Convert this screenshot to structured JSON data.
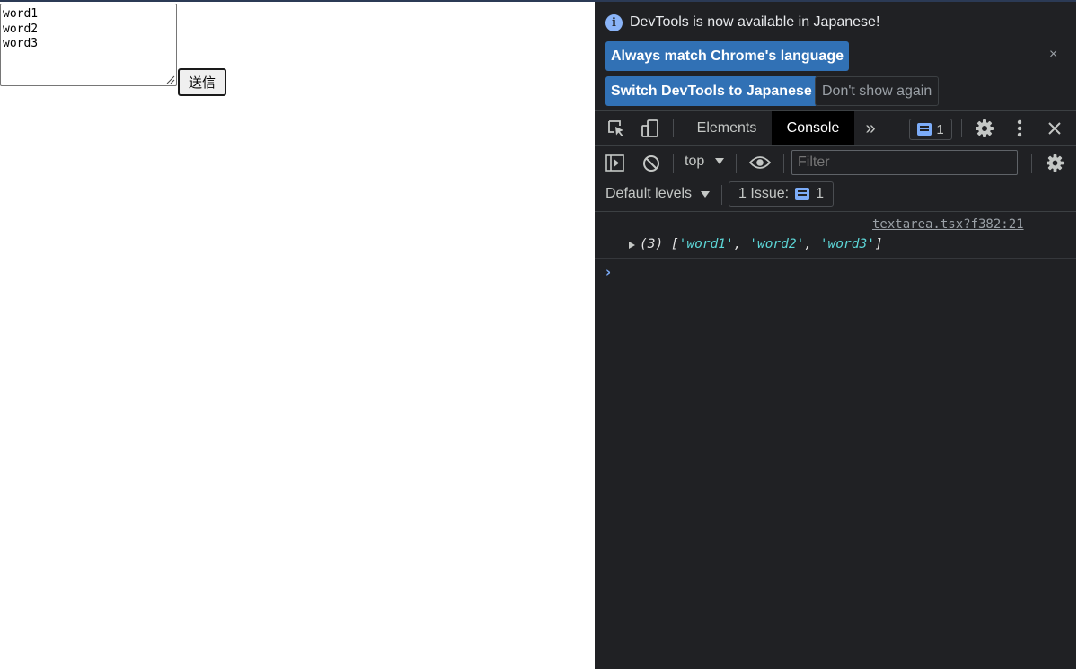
{
  "page": {
    "textarea_value": "word1\nword2\nword3",
    "submit_label": "送信"
  },
  "devtools": {
    "infobar": {
      "message": "DevTools is now available in Japanese!",
      "match_language_label": "Always match Chrome's language",
      "switch_label": "Switch DevTools to Japanese",
      "dismiss_label": "Don't show again",
      "close_symbol": "×"
    },
    "tabs": {
      "elements": "Elements",
      "console": "Console",
      "more": "»"
    },
    "issues_badge_count": "1",
    "console_toolbar": {
      "context": "top",
      "filter_placeholder": "Filter",
      "default_levels": "Default levels",
      "issues_label": "1 Issue:",
      "issues_count": "1"
    },
    "console_messages": [
      {
        "source": "textarea.tsx?f382:21",
        "prefix": "(3) [",
        "values": [
          "'word1'",
          "'word2'",
          "'word3'"
        ],
        "separator": ", ",
        "suffix": "]"
      }
    ],
    "prompt_symbol": "›"
  },
  "colors": {
    "devtools_bg": "#202124",
    "blue_button": "#3171b5",
    "string_value": "#5cd5d6",
    "accent_blue": "#7cacf8"
  },
  "icons": [
    "info-icon",
    "inspect-element-icon",
    "device-toolbar-icon",
    "chevron-double-right-icon",
    "message-icon",
    "settings-gear-icon",
    "more-vertical-icon",
    "close-icon",
    "sidebar-toggle-icon",
    "clear-console-icon",
    "dropdown-arrow-icon",
    "eye-icon",
    "prompt-chevron-icon"
  ]
}
